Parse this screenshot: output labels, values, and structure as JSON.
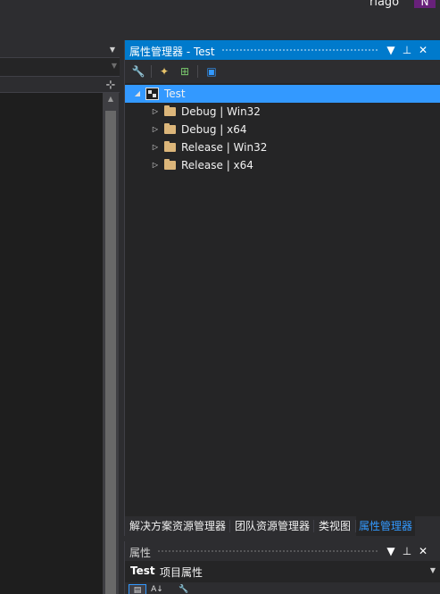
{
  "header": {
    "user_name": "riago",
    "avatar_initial": "N"
  },
  "left_pane": {
    "dropdown_arrow": "▼",
    "split_icon": "⊹"
  },
  "property_manager": {
    "title": "属性管理器 - Test",
    "title_buttons": {
      "dropdown": "▼",
      "pin": "⊥",
      "close": "✕"
    },
    "toolbar": [
      {
        "icon": "wrench-icon",
        "glyph": "🔧"
      },
      {
        "icon": "add-new-property-sheet-icon",
        "glyph": "✦"
      },
      {
        "icon": "add-existing-property-sheet-icon",
        "glyph": "⊞"
      },
      {
        "icon": "save-icon",
        "glyph": "▣"
      }
    ],
    "tree": {
      "root": {
        "label": "Test",
        "expanded": true,
        "selected": true
      },
      "children": [
        {
          "label": "Debug | Win32"
        },
        {
          "label": "Debug | x64"
        },
        {
          "label": "Release | Win32"
        },
        {
          "label": "Release | x64"
        }
      ]
    },
    "tabs": [
      {
        "label": "解决方案资源管理器",
        "active": false
      },
      {
        "label": "团队资源管理器",
        "active": false
      },
      {
        "label": "类视图",
        "active": false
      },
      {
        "label": "属性管理器",
        "active": true
      }
    ]
  },
  "properties_panel": {
    "title": "属性",
    "object_name": "Test",
    "object_type": "项目属性",
    "toolbar": [
      {
        "icon": "categorized-icon",
        "glyph": "▤",
        "active": true
      },
      {
        "icon": "alphabetical-icon",
        "glyph": "A↓",
        "active": false
      },
      {
        "icon": "property-pages-icon",
        "glyph": "🔧",
        "active": false
      }
    ]
  },
  "colors": {
    "accent": "#007acc",
    "selection": "#3399ff",
    "background": "#2d2d30",
    "panel": "#252526",
    "editor": "#1e1e1e",
    "folder": "#dcb67a",
    "avatar": "#68217a"
  }
}
